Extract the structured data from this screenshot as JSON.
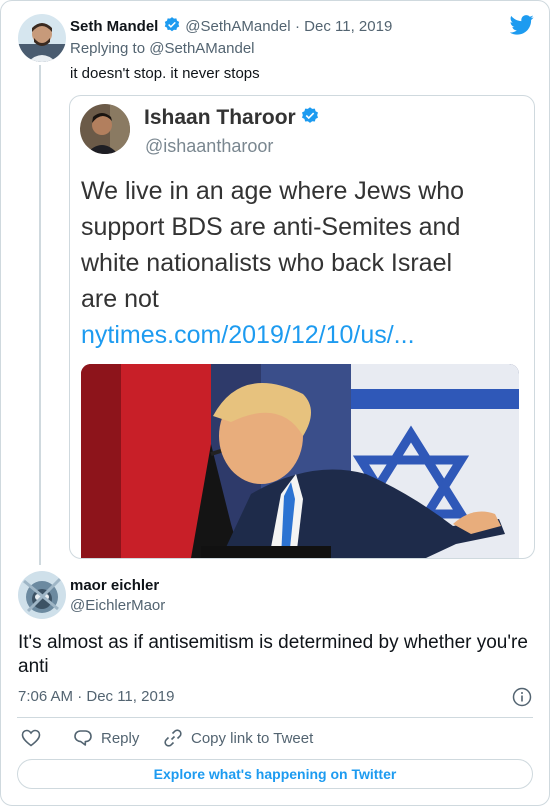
{
  "tweet": {
    "author_name": "Seth Mandel",
    "author_handle": "@SethAMandel",
    "date": "· Dec 11, 2019",
    "replying_to": "Replying to @SethAMandel",
    "text": "it doesn't stop. it never stops"
  },
  "quoted": {
    "author_name": "Ishaan Tharoor",
    "author_handle": "@ishaantharoor",
    "text_lines": [
      "We live in an age where Jews who",
      "support BDS are anti-Semites and",
      "white nationalists who back Israel",
      "are not"
    ],
    "link": "nytimes.com/2019/12/10/us/..."
  },
  "reply": {
    "author_name": "maor eichler",
    "author_handle": "@EichlerMaor",
    "text": "It's almost as if antisemitism is determined by whether you're anti",
    "timestamp": "7:06 AM · Dec 11, 2019"
  },
  "actions": {
    "reply_label": "Reply",
    "copy_label": "Copy link to Tweet"
  },
  "explore_label": "Explore what's happening on Twitter",
  "colors": {
    "twitter_blue": "#1d9bf0",
    "muted": "#536471",
    "border": "#cfd9de"
  },
  "icons": [
    "twitter-logo-icon",
    "verified-badge-icon",
    "info-icon",
    "heart-icon",
    "reply-icon",
    "link-icon"
  ]
}
